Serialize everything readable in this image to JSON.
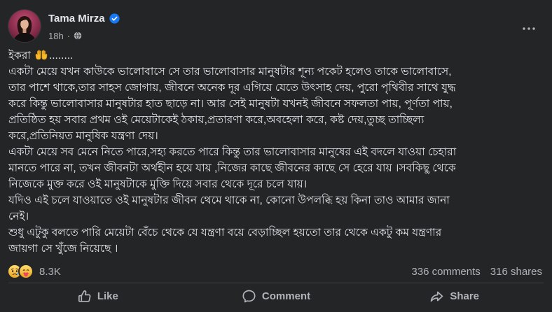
{
  "post": {
    "author": "Tama Mirza",
    "badge_icon": "verified-badge-icon",
    "time": "18h",
    "separator": "·",
    "privacy_icon": "globe-icon",
    "menu_icon": "more-horizontal-icon",
    "first_line": {
      "word": "ইকরা",
      "emoji_icon": "palms-up-emoji-icon",
      "suffix": "........"
    },
    "body_lines": [
      "একটা মেয়ে যখন কাউকে ভালোবাসে সে তার ভালোবাসার মানুষটার শূন্য পকেট হলেও তাকে ভালোবাসে,",
      "তার পাশে থাকে,তার সাহস জোগায়, জীবনে অনেক দূর এগিয়ে যেতে উৎসাহ দেয়, পুরো পৃথিবীর সাথে যুদ্ধ",
      "করে কিন্তু ভালোবাসার মানুষটার হাত ছাড়ে না। আর সেই মানুষটা যখনই জীবনে সফলতা পায়, পূর্ণতা পায়,",
      "প্রতিষ্ঠিত হয় সবার প্রথম ওই মেয়েটাকেই ঠকায়,প্রতারণা করে,অবহেলা করে, কষ্ট দেয়,তুচ্ছ তাচ্ছিল্য",
      "করে,প্রতিনিয়ত মানুষিক যন্ত্রণা দেয়।",
      "একটা মেয়ে সব মেনে নিতে পারে,সহ্য করতে পারে কিন্তু তার ভালোবাসার মানুষের এই বদলে যাওয়া চেহারা",
      "মানতে পারে না, তখন জীবনটা অর্থহীন হয়ে যায় ,নিজের কাছে জীবনের কাছে সে হেরে যায় ।সবকিছু থেকে",
      "নিজেকে মুক্ত করে ওই মানুষটাকে মুক্তি দিয়ে সবার থেকে দূরে চলে যায়।",
      "যদিও এই চলে যাওয়াতে ওই মানুষটার জীবন থেমে থাকে না, কোনো উপলব্ধি হয় কিনা তাও আমার জানা",
      "নেই।",
      "শুধু এটুকু বলতে পারি মেয়েটা বেঁচে থেকে যে যন্ত্রণা বয়ে বেড়াচ্ছিল হয়তো তার থেকে একটু কম যন্ত্রণার",
      "জায়গা সে খুঁজে নিয়েছে ।"
    ]
  },
  "stats": {
    "reaction_icons": [
      "sad-reaction-icon",
      "care-reaction-icon"
    ],
    "reaction_count": "8.3K",
    "comments": "336 comments",
    "shares": "316 shares"
  },
  "actions": [
    {
      "label": "Like",
      "icon": "like-icon"
    },
    {
      "label": "Comment",
      "icon": "comment-icon"
    },
    {
      "label": "Share",
      "icon": "share-icon"
    }
  ],
  "colors": {
    "background": "#242526",
    "text_primary": "#e4e6eb",
    "text_secondary": "#b0b3b8",
    "divider": "#3e4042",
    "verified_badge": "#1877f2"
  }
}
